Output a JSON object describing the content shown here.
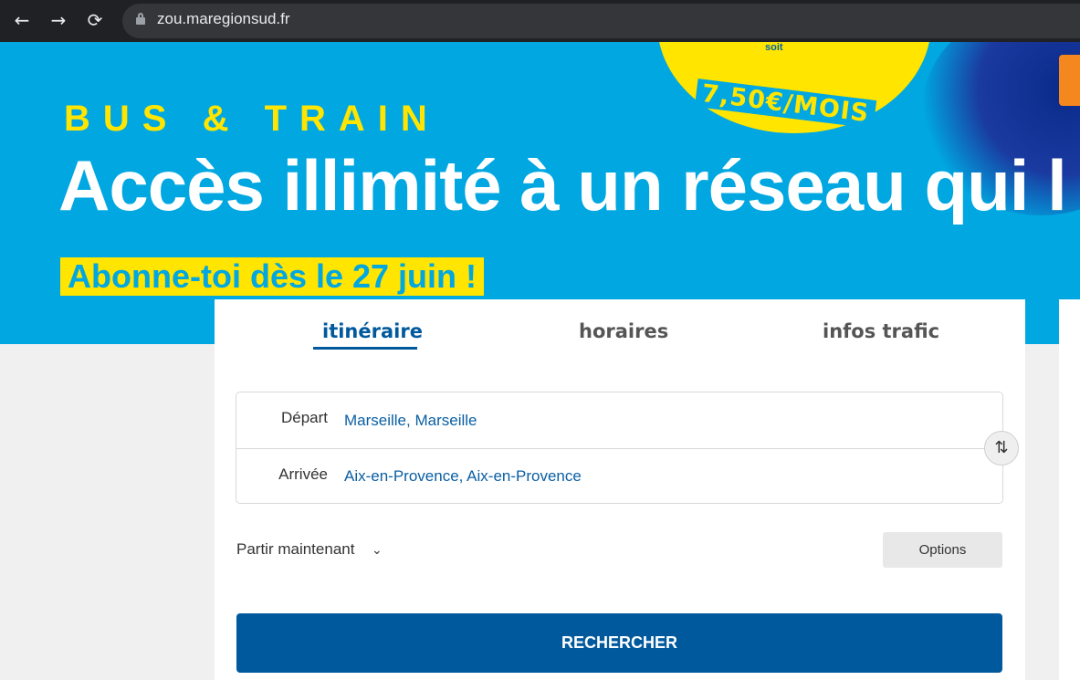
{
  "browser": {
    "url": "zou.maregionsud.fr",
    "back_glyph": "←",
    "forward_glyph": "→",
    "reload_glyph": "⟳"
  },
  "hero": {
    "kicker": "BUS & TRAIN",
    "headline": "Accès illimité à un réseau qui l",
    "subline": "Abonne-toi dès le 27 juin !",
    "promo_soit": "soit",
    "promo_price": "7,50€/MOIS",
    "colors": {
      "background": "#00a7e1",
      "yellow": "#ffe500",
      "orange": "#f5871f"
    }
  },
  "tabs": [
    {
      "label": "itinéraire",
      "active": true
    },
    {
      "label": "horaires",
      "active": false
    },
    {
      "label": "infos trafic",
      "active": false
    }
  ],
  "route": {
    "departure_label": "Départ",
    "departure_value": "Marseille, Marseille",
    "arrival_label": "Arrivée",
    "arrival_value": "Aix-en-Provence, Aix-en-Provence",
    "swap_icon": "swap-vertical-icon",
    "swap_glyph": "⇅"
  },
  "when": {
    "label": "Partir maintenant",
    "chevron": "⌄"
  },
  "options_label": "Options",
  "search_label": "RECHERCHER",
  "accent": "#00599d"
}
